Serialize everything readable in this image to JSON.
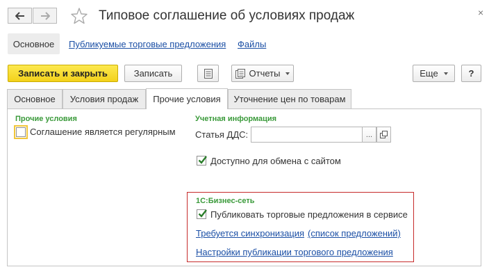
{
  "window": {
    "title": "Типовое соглашение об условиях продаж",
    "close_glyph": "×"
  },
  "sections": {
    "active": "Основное",
    "links": [
      "Публикуемые торговые предложения",
      "Файлы"
    ]
  },
  "toolbar": {
    "save_close_label": "Записать и закрыть",
    "save_label": "Записать",
    "reports_label": "Отчеты",
    "more_label": "Еще",
    "help_label": "?"
  },
  "tabs": [
    "Основное",
    "Условия продаж",
    "Прочие условия",
    "Уточнение цен по товарам"
  ],
  "active_tab": "Прочие условия",
  "other_conditions": {
    "group_title": "Прочие условия",
    "regular_label": "Соглашение является регулярным",
    "regular_checked": false
  },
  "accounting": {
    "group_title": "Учетная информация",
    "dds_label": "Статья ДДС:",
    "dds_value": "",
    "select_btn": "...",
    "site_exchange_label": "Доступно для обмена с сайтом",
    "site_exchange_checked": true
  },
  "business_network": {
    "group_title": "1С:Бизнес-сеть",
    "publish_label": "Публиковать торговые предложения в сервисе",
    "publish_checked": true,
    "sync_link": "Требуется синхронизация",
    "offers_link": "(список предложений)",
    "settings_link": "Настройки публикации торгового предложения"
  },
  "colors": {
    "primary_button": "#f3d21b",
    "link": "#1b4fa5",
    "group_title": "#3a9a3a",
    "highlight_border": "#c62a2a"
  },
  "icons": [
    "back-arrow-icon",
    "forward-arrow-icon",
    "star-icon",
    "close-icon",
    "list-icon",
    "reports-icon",
    "open-icon",
    "checkmark-icon"
  ]
}
